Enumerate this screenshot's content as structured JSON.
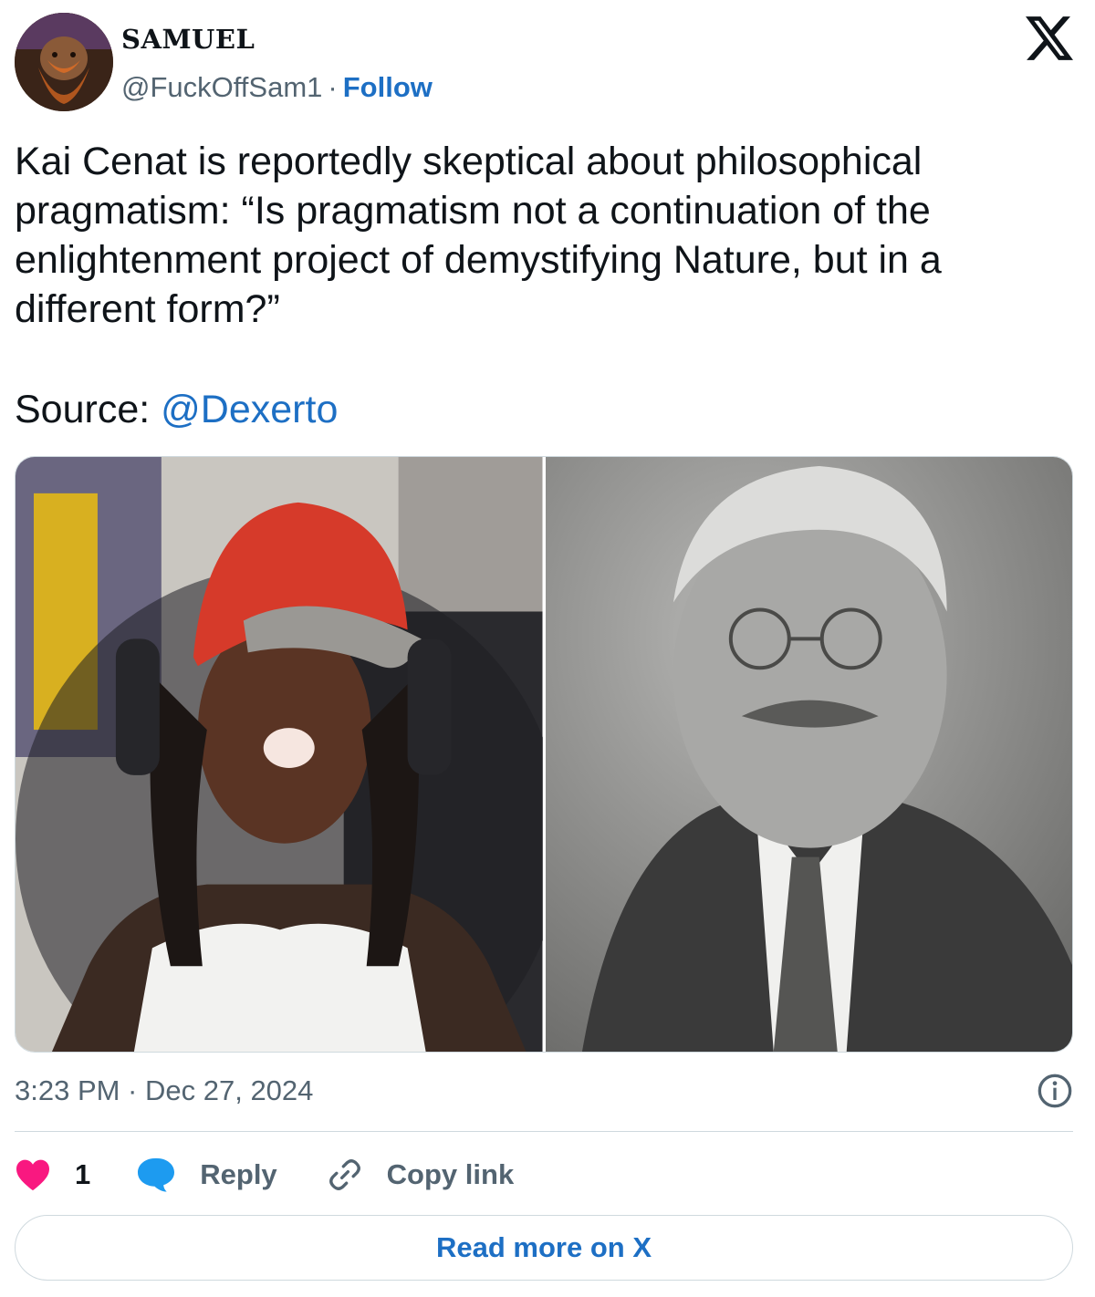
{
  "author": {
    "name": "SAMUEL",
    "handle": "@FuckOffSam1",
    "separator": "·",
    "follow_label": "Follow"
  },
  "platform": {
    "logo_icon": "x-logo-icon"
  },
  "tweet": {
    "text": "Kai Cenat is reportedly skeptical about philosophical\npragmatism: “Is pragmatism not a continuation of the\nenlightenment project of demystifying Nature, but in a\ndifferent form?”",
    "source_label": "Source: ",
    "source_mention": "@Dexerto",
    "timestamp": "3:23 PM · Dec 27, 2024"
  },
  "media": {
    "photos": [
      {
        "icon": "photo-streamer"
      },
      {
        "icon": "photo-portrait-bw"
      }
    ]
  },
  "actions": {
    "like_count": "1",
    "reply_label": "Reply",
    "copy_label": "Copy link",
    "read_more_label": "Read more on X"
  },
  "colors": {
    "link": "#1d6fc4",
    "like": "#f91880",
    "reply": "#1d9bf0",
    "muted": "#536471",
    "text": "#0f1419"
  }
}
